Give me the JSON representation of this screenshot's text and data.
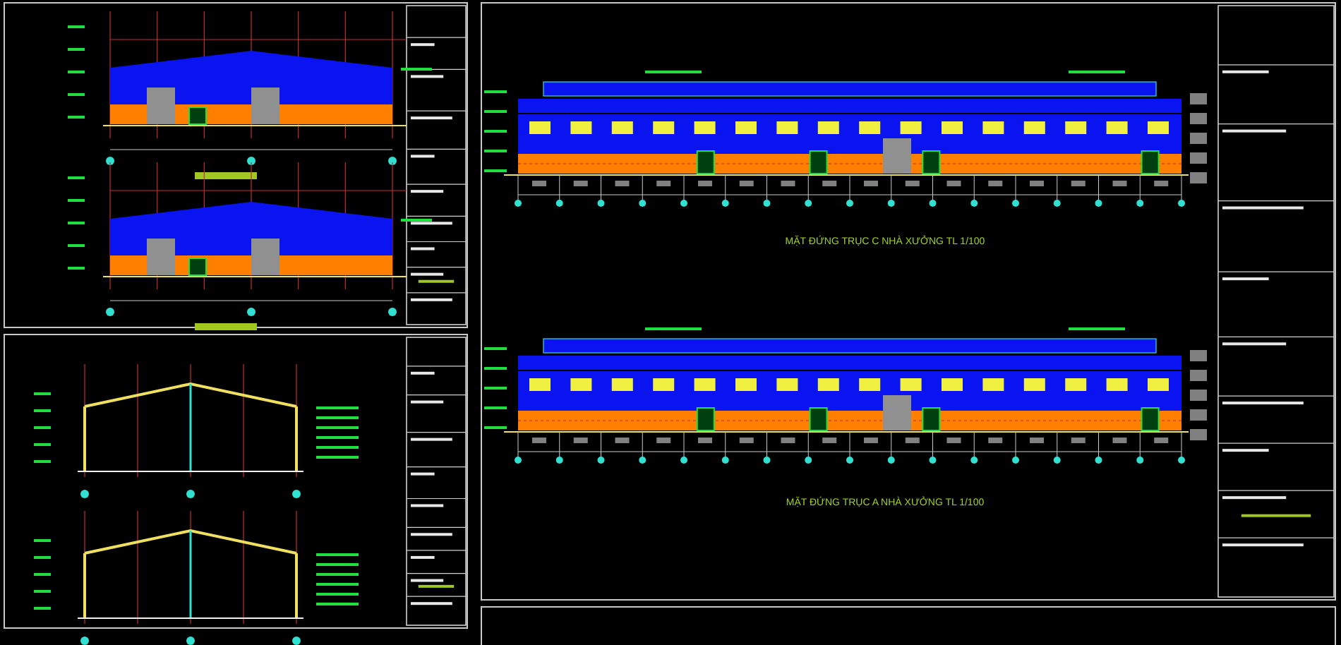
{
  "elevation_captions": [
    {
      "text": "MẶT ĐỨNG TRỤC C NHÀ XƯỞNG TL 1/100"
    },
    {
      "text": "MẶT ĐỨNG TRỤC A NHÀ XƯỞNG TL 1/100"
    }
  ]
}
